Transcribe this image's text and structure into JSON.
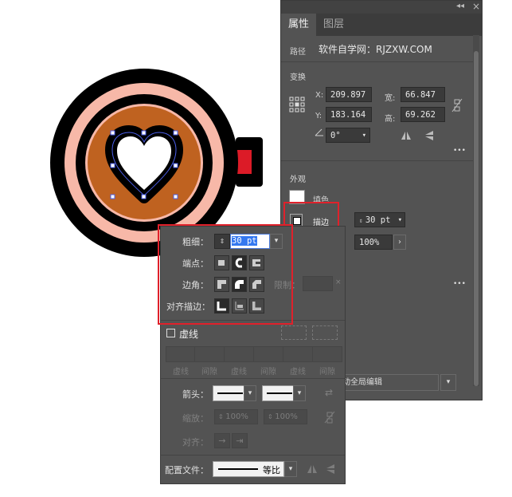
{
  "panel": {
    "tabs": [
      "属性",
      "图层"
    ],
    "path_label": "路径",
    "path_value": "软件自学网：RJZXW.COM",
    "transform_title": "变换",
    "x_label": "X:",
    "x_value": "209.897",
    "y_label": "Y:",
    "y_value": "183.164",
    "w_label": "宽:",
    "w_value": "66.847 m",
    "h_label": "高:",
    "h_value": "69.262 m",
    "angle_value": "0°",
    "appearance_title": "外观",
    "fill_label": "填色",
    "stroke_label": "描边",
    "stroke_weight": "30 pt",
    "opacity_value": "100%",
    "global_edit_label": "启动全局编辑",
    "more_glyph": "•••",
    "collapse_glyph": "◂◂",
    "close_glyph": "×"
  },
  "stroke_panel": {
    "weight_label": "粗细：",
    "weight_value": "30 pt",
    "cap_label": "端点：",
    "corner_label": "边角：",
    "limit_label": "限制：",
    "align_label": "对齐描边：",
    "dashed_label": "虚线",
    "dash_labels": [
      "虚线",
      "间隙",
      "虚线",
      "间隙",
      "虚线",
      "间隙"
    ],
    "arrow_label": "箭头：",
    "scale_label": "缩放：",
    "scale_start": "100%",
    "scale_end": "100%",
    "align2_label": "对齐：",
    "profile_label": "配置文件：",
    "profile_value": "等比"
  },
  "artwork": {
    "colors": {
      "outer_ring": "#000000",
      "peach_ring": "#f7b8a8",
      "cup_fill": "#bf6220",
      "heart": "#ffffff",
      "handle": "#000000",
      "handle_accent": "#dc1b27",
      "selection": "#4a5ee8"
    }
  },
  "highlight_color": "#e0212b"
}
